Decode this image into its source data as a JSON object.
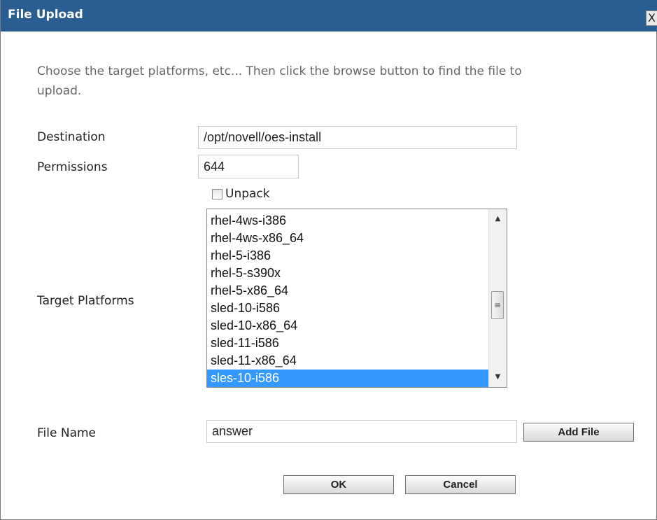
{
  "dialog": {
    "title": "File Upload",
    "close_label": "X",
    "instructions": "Choose the target platforms, etc... Then click the browse button to find the file to upload."
  },
  "form": {
    "destination": {
      "label": "Destination",
      "value": "/opt/novell/oes-install"
    },
    "permissions": {
      "label": "Permissions",
      "value": "644"
    },
    "unpack": {
      "label": "Unpack",
      "checked": false
    },
    "target_platforms": {
      "label": "Target Platforms",
      "options": [
        "rhel-4ws-i386",
        "rhel-4ws-x86_64",
        "rhel-5-i386",
        "rhel-5-s390x",
        "rhel-5-x86_64",
        "sled-10-i586",
        "sled-10-x86_64",
        "sled-11-i586",
        "sled-11-x86_64",
        "sles-10-i586"
      ],
      "selected": "sles-10-i586"
    },
    "file_name": {
      "label": "File Name",
      "value": "answer"
    },
    "add_file_label": "Add File"
  },
  "actions": {
    "ok_label": "OK",
    "cancel_label": "Cancel"
  },
  "colors": {
    "title_bar": "#2a5e92",
    "selection": "#3399ff"
  }
}
